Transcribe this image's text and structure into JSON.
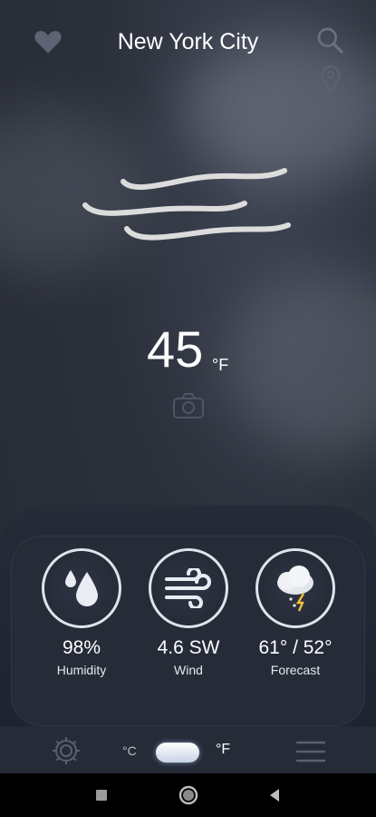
{
  "header": {
    "city": "New York City"
  },
  "current": {
    "temperature": "45",
    "unit": "°F"
  },
  "stats": [
    {
      "value": "98%",
      "label": "Humidity",
      "icon": "water-drop-icon"
    },
    {
      "value": "4.6 SW",
      "label": "Wind",
      "icon": "wind-icon"
    },
    {
      "value": "61° / 52°",
      "label": "Forecast",
      "icon": "thunderstorm-icon"
    }
  ],
  "units": {
    "celsius": "°C",
    "fahrenheit": "°F",
    "selected": "fahrenheit"
  },
  "icons": {
    "favorite": "heart-icon",
    "search": "search-icon",
    "location": "location-pin-icon",
    "condition": "windy-icon",
    "camera": "camera-icon",
    "settings": "gear-icon",
    "menu": "menu-icon"
  },
  "colors": {
    "background": "#2b303b",
    "panel": "#262b38",
    "ring": "#dfe3ea"
  }
}
